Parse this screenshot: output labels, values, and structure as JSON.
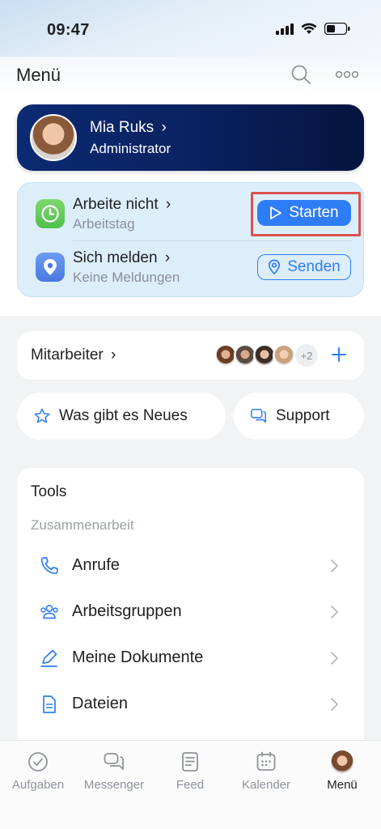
{
  "status": {
    "time": "09:47"
  },
  "header": {
    "title": "Menü"
  },
  "profile": {
    "name": "Mia Ruks",
    "role": "Administrator"
  },
  "workday": {
    "status_title": "Arbeite nicht",
    "status_sub": "Arbeitstag",
    "start_label": "Starten",
    "report_title": "Sich melden",
    "report_sub": "Keine Meldungen",
    "send_label": "Senden"
  },
  "staff": {
    "label": "Mitarbeiter",
    "more_count": "+2"
  },
  "quick": {
    "news_label": "Was gibt es Neues",
    "support_label": "Support"
  },
  "tools": {
    "title": "Tools",
    "section": "Zusammenarbeit",
    "items": [
      {
        "label": "Anrufe",
        "icon": "phone-icon"
      },
      {
        "label": "Arbeitsgruppen",
        "icon": "group-icon"
      },
      {
        "label": "Meine Dokumente",
        "icon": "pen-icon"
      },
      {
        "label": "Dateien",
        "icon": "file-icon"
      }
    ]
  },
  "tabs": [
    {
      "label": "Aufgaben",
      "icon": "check-circle-icon"
    },
    {
      "label": "Messenger",
      "icon": "chat-icon"
    },
    {
      "label": "Feed",
      "icon": "feed-icon"
    },
    {
      "label": "Kalender",
      "icon": "calendar-icon"
    },
    {
      "label": "Menü",
      "icon": "avatar-icon",
      "active": true
    }
  ],
  "colors": {
    "accent": "#2f7df6",
    "profile_bg": "#0a2260",
    "highlight": "#d9534f"
  }
}
